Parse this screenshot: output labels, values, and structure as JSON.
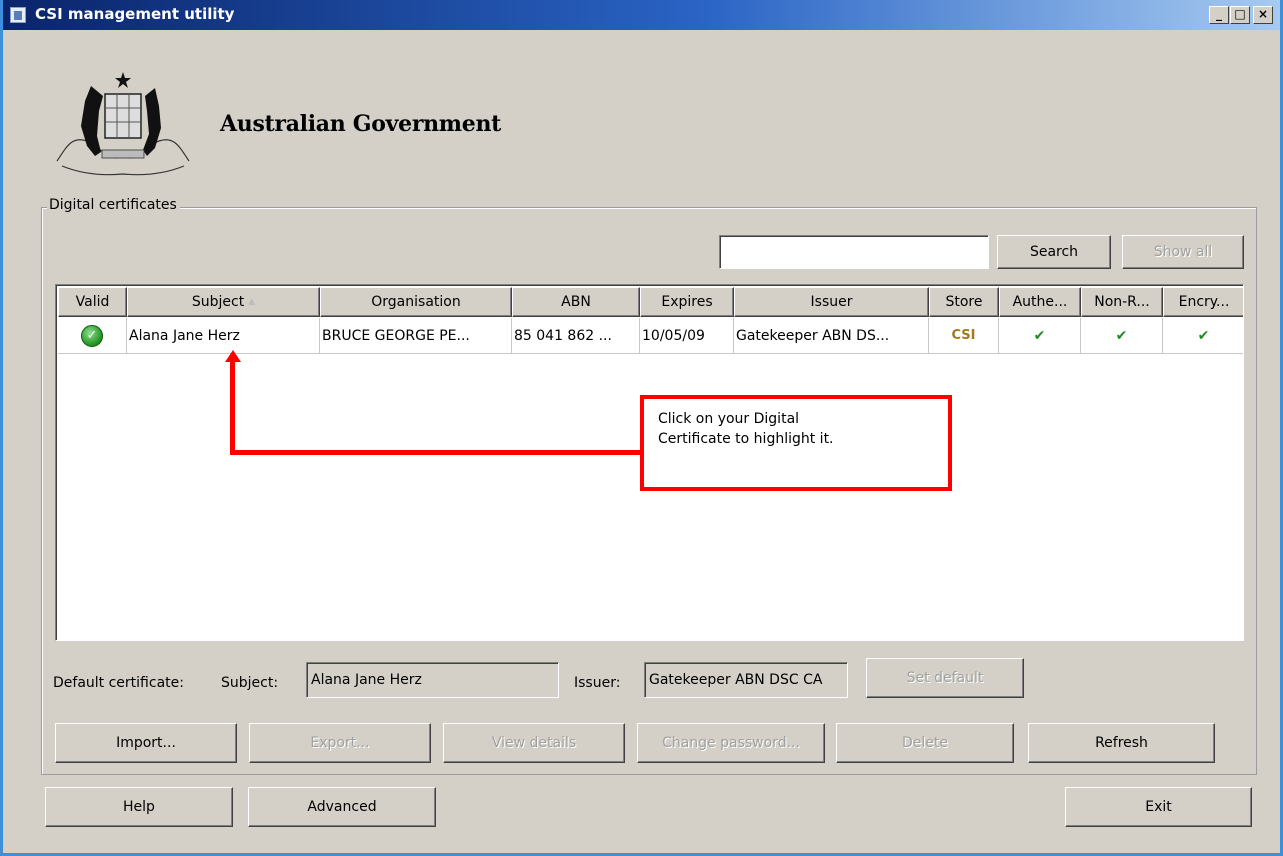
{
  "window": {
    "title": "CSI management utility",
    "controls": {
      "minimize": "_",
      "maximize": "□",
      "close": "×"
    }
  },
  "header": {
    "org_name": "Australian Government",
    "crest_icon": "coat-of-arms-icon"
  },
  "certificates": {
    "group_label": "Digital certificates",
    "search_placeholder": "",
    "search_label": "Search",
    "show_all_label": "Show all",
    "columns": [
      "Valid",
      "Subject",
      "Organisation",
      "ABN",
      "Expires",
      "Issuer",
      "Store",
      "Authe...",
      "Non-R...",
      "Encry..."
    ],
    "sorted_column": "Subject",
    "rows": [
      {
        "valid": "valid-check-icon",
        "subject": "Alana Jane Herz",
        "organisation": "BRUCE GEORGE PE...",
        "abn": "85 041 862 ...",
        "expires": "10/05/09",
        "issuer": "Gatekeeper ABN DS...",
        "store": "CSI",
        "authentication": "✔",
        "non_repudiation": "✔",
        "encryption": "✔"
      }
    ]
  },
  "callout": {
    "text_line1": "Click on your Digital",
    "text_line2": "Certificate to highlight it."
  },
  "default_cert": {
    "label": "Default certificate:",
    "subject_label": "Subject:",
    "subject_value": "Alana Jane Herz",
    "issuer_label": "Issuer:",
    "issuer_value": "Gatekeeper ABN DSC CA",
    "set_default_label": "Set default"
  },
  "actions": {
    "import": "Import...",
    "export": "Export...",
    "view_details": "View details",
    "change_password": "Change password...",
    "delete": "Delete",
    "refresh": "Refresh"
  },
  "footer": {
    "help": "Help",
    "advanced": "Advanced",
    "exit": "Exit"
  },
  "colors": {
    "title_bar": "#0a246a",
    "dialog_bg": "#d4d0c8",
    "callout_border": "#ff0000",
    "tick_green": "#1e8c1e",
    "store_gold": "#a07a1e"
  }
}
